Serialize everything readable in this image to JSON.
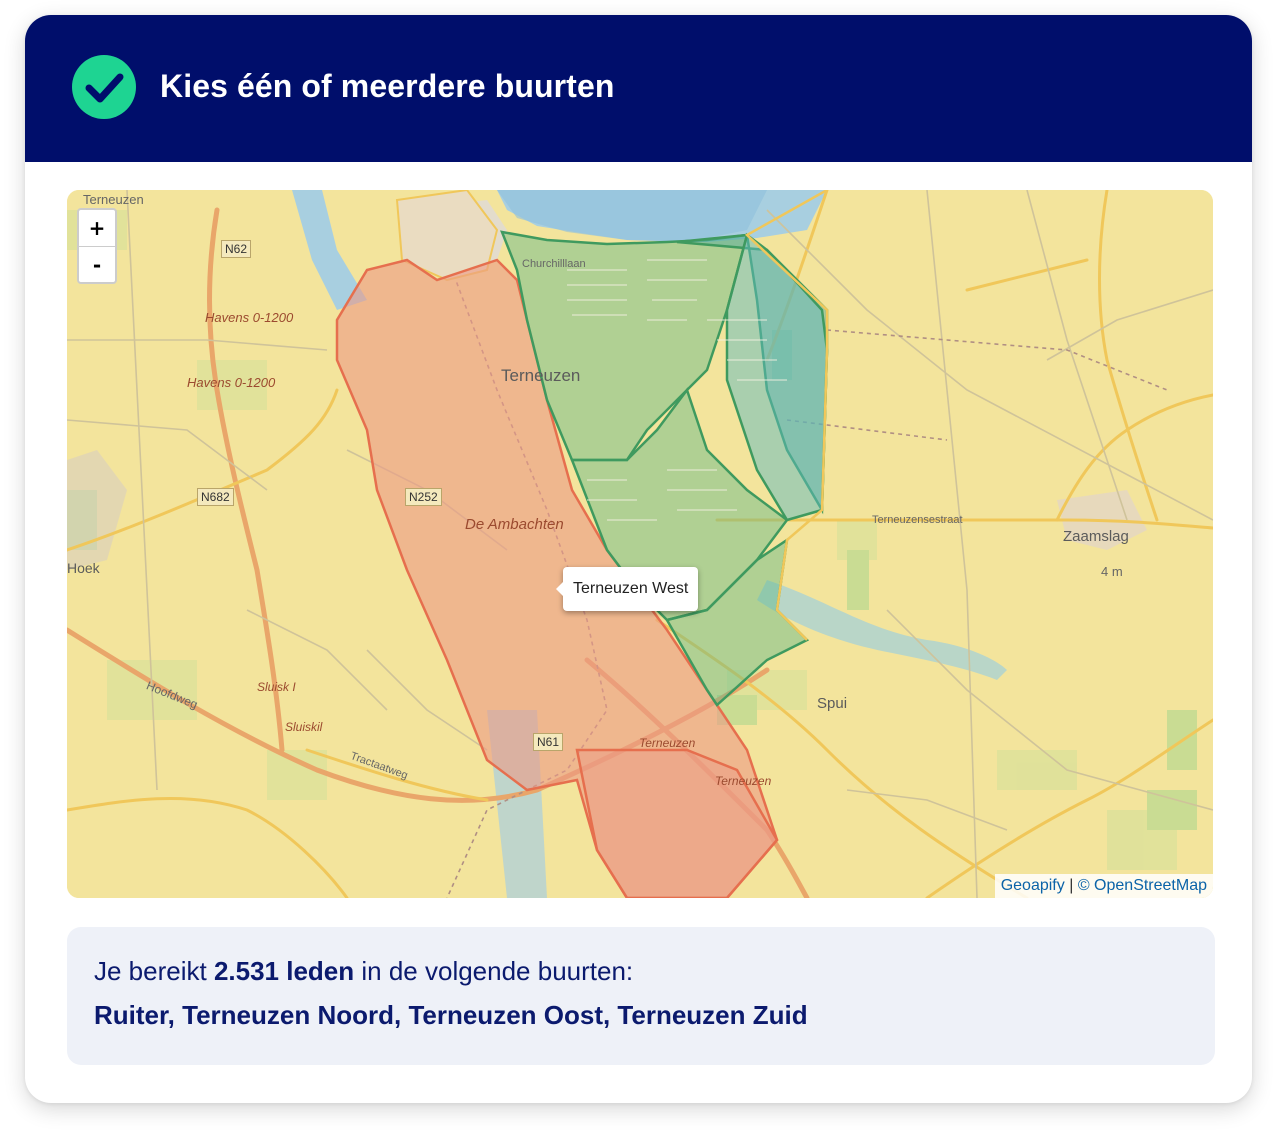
{
  "header": {
    "title": "Kies één of meerdere buurten",
    "check_color": "#1ed492",
    "background_color": "#000e6b"
  },
  "map": {
    "zoom_in_label": "+",
    "zoom_out_label": "-",
    "tooltip": "Terneuzen West",
    "attribution": {
      "provider": "Geoapify",
      "separator": "|",
      "copyright": "© OpenStreetMap"
    },
    "labels": {
      "terneuzen": "Terneuzen",
      "terneuzen_top": "Terneuzen",
      "de_ambachten": "De Ambachten",
      "zaamslag": "Zaamslag",
      "spui": "Spui",
      "hoek": "Hoek",
      "havens_1": "Havens 0-1200",
      "havens_2": "Havens 0-1200",
      "churchilllaan": "Churchilllaan",
      "terneuzensestraat": "Terneuzensestraat",
      "hoofdweg": "Hoofdweg",
      "tractaatweg": "Tractaatweg",
      "sluiskil": "Sluiskil",
      "sluis_i": "Sluisk I",
      "terneuzen_road_1": "Terneuzen",
      "terneuzen_road_2": "Terneuzen",
      "n62": "N62",
      "n682": "N682",
      "n252": "N252",
      "n61": "N61",
      "height": "4 m"
    },
    "selected_color": "#e98b7a",
    "unselected_color": "#5fb98a"
  },
  "summary": {
    "prefix": "Je bereikt ",
    "members": "2.531 leden",
    "suffix": " in de volgende buurten:",
    "neighbourhoods": "Ruiter, Terneuzen Noord, Terneuzen Oost, Terneuzen Zuid"
  }
}
